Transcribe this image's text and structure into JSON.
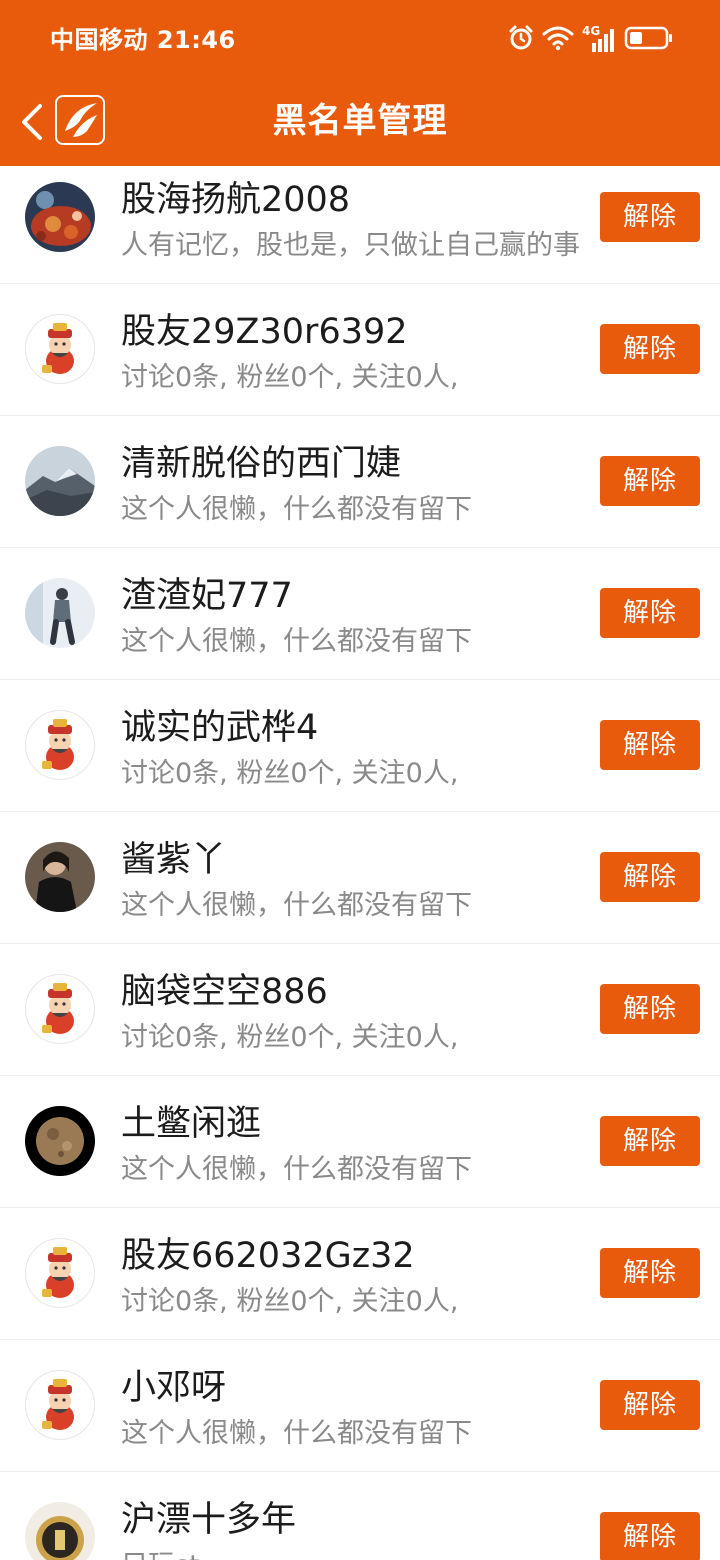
{
  "status_bar": {
    "carrier_time": "中国移动 21:46",
    "network_label": "4G",
    "icons": [
      "alarm-icon",
      "wifi-icon",
      "signal-icon",
      "battery-icon"
    ]
  },
  "nav": {
    "title": "黑名单管理",
    "back_icon": "chevron-left-icon",
    "logo_icon": "app-logo-icon"
  },
  "colors": {
    "brand": "#e85a0c",
    "text_primary": "#1c1c1c",
    "text_secondary": "#8a8a8a"
  },
  "action_label": "解除",
  "blocked_users": [
    {
      "name": "股海扬航2008",
      "desc": "人有记忆，股也是，只做让自己赢的事",
      "avatar": "photo-food"
    },
    {
      "name": "股友29Z30r6392",
      "desc": "讨论0条, 粉丝0个, 关注0人,",
      "avatar": "default-fortune-god"
    },
    {
      "name": "清新脱俗的西门婕",
      "desc": "这个人很懒，什么都没有留下",
      "avatar": "photo-mountain"
    },
    {
      "name": "渣渣妃777",
      "desc": "这个人很懒，什么都没有留下",
      "avatar": "photo-person-walking"
    },
    {
      "name": "诚实的武桦4",
      "desc": "讨论0条, 粉丝0个, 关注0人,",
      "avatar": "default-fortune-god"
    },
    {
      "name": "酱紫丫",
      "desc": "这个人很懒，什么都没有留下",
      "avatar": "photo-portrait"
    },
    {
      "name": "脑袋空空886",
      "desc": "讨论0条, 粉丝0个, 关注0人,",
      "avatar": "default-fortune-god"
    },
    {
      "name": "土鳖闲逛",
      "desc": "这个人很懒，什么都没有留下",
      "avatar": "photo-moon"
    },
    {
      "name": "股友662032Gz32",
      "desc": "讨论0条, 粉丝0个, 关注0人,",
      "avatar": "default-fortune-god"
    },
    {
      "name": "小邓呀",
      "desc": "这个人很懒，什么都没有留下",
      "avatar": "default-fortune-god"
    },
    {
      "name": "沪漂十多年",
      "desc": "只玩st",
      "avatar": "photo-coin"
    }
  ]
}
